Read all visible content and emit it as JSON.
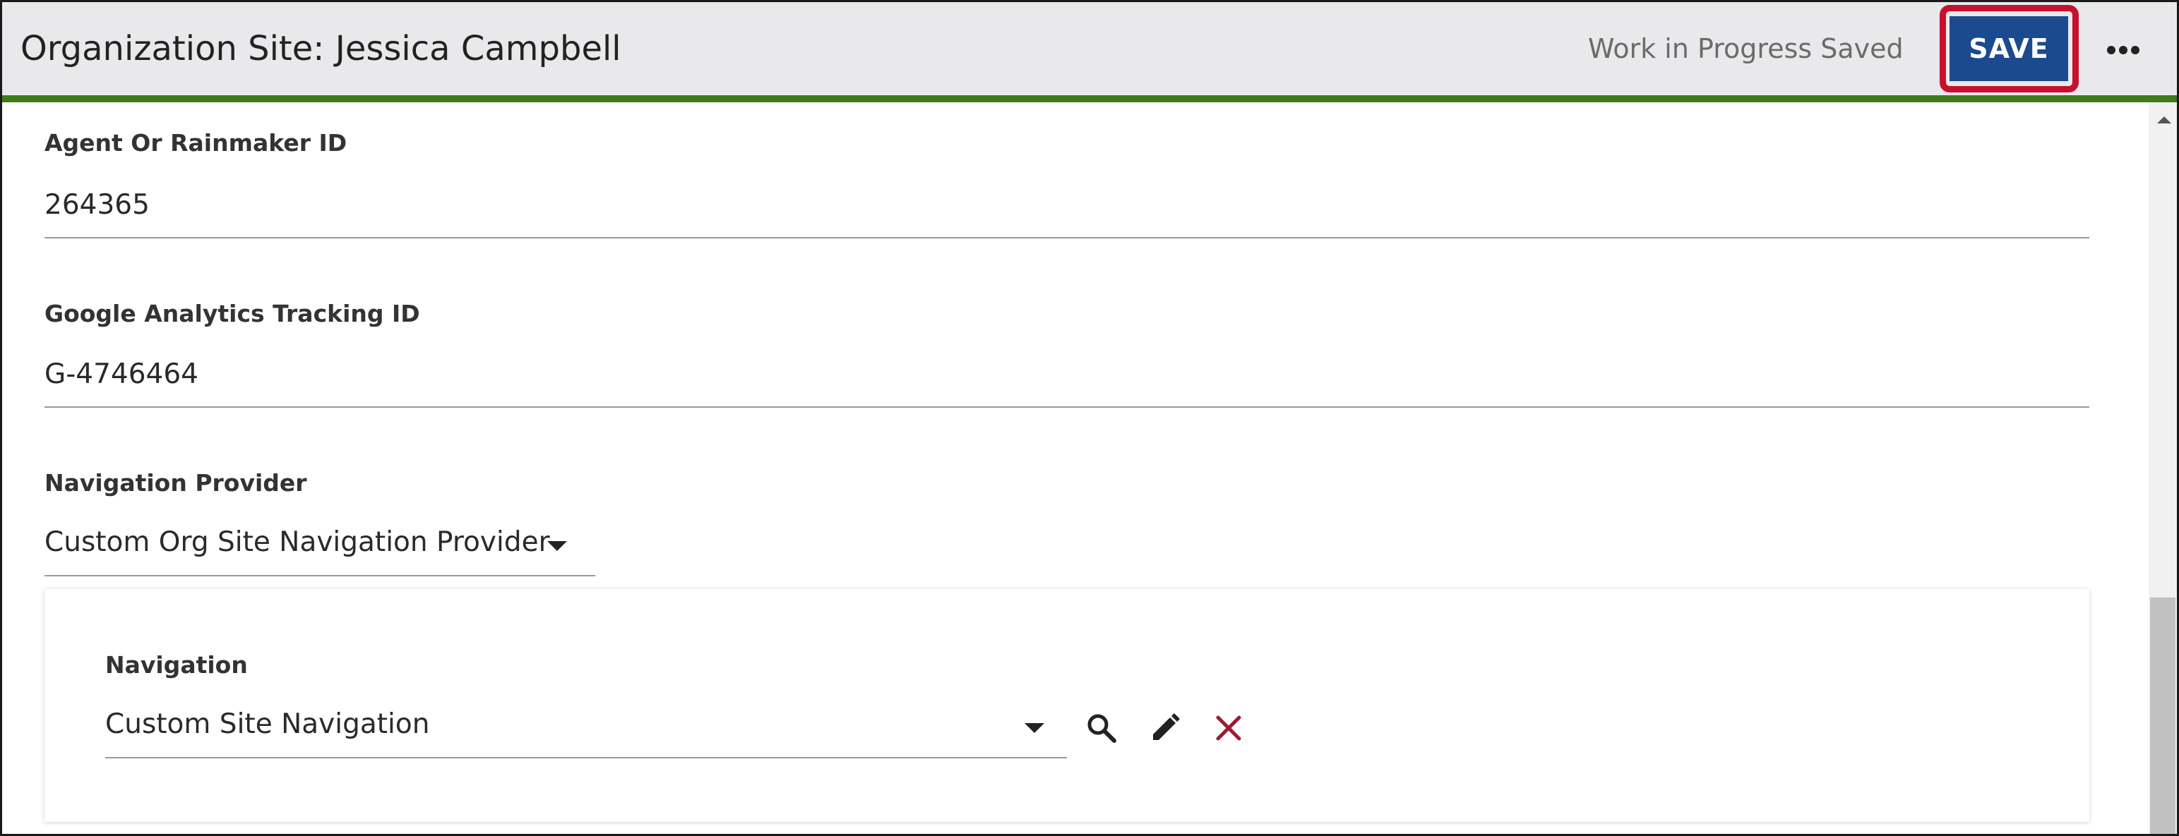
{
  "header": {
    "title": "Organization Site: Jessica Campbell",
    "status": "Work in Progress Saved",
    "save_label": "SAVE",
    "more_icon": "more-horizontal-icon",
    "accent_color": "#3f7b19",
    "save_color": "#1c4a8f",
    "highlight_color": "#c8102e"
  },
  "form": {
    "agent_id": {
      "label": "Agent Or Rainmaker ID",
      "value": "264365"
    },
    "ga_tracking_id": {
      "label": "Google Analytics Tracking ID",
      "value": "G-4746464"
    },
    "navigation_provider": {
      "label": "Navigation Provider",
      "value": "Custom Org Site Navigation Provider"
    },
    "navigation": {
      "label": "Navigation",
      "value": "Custom Site Navigation",
      "actions": [
        "search-icon",
        "edit-pencil-icon",
        "clear-x-icon"
      ]
    }
  }
}
